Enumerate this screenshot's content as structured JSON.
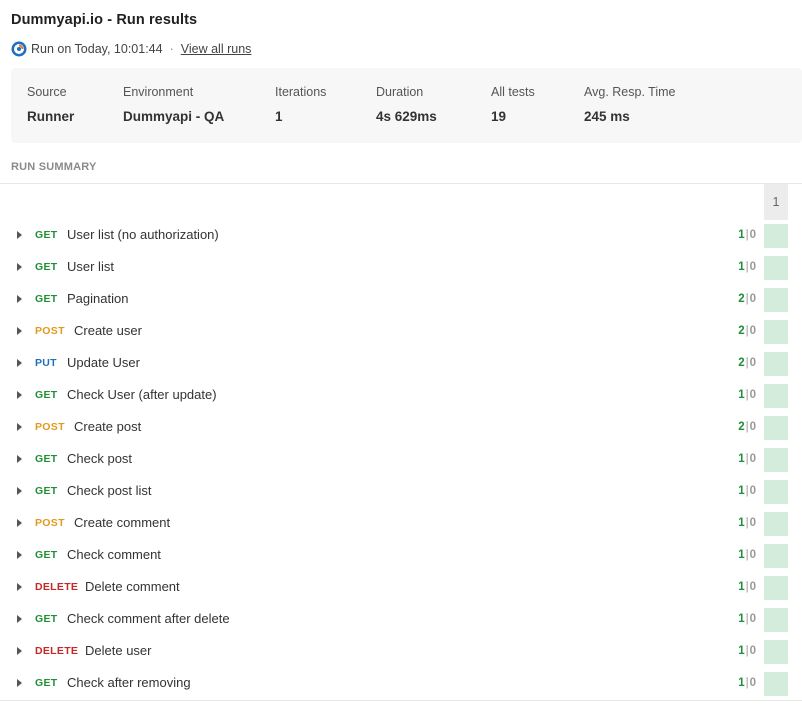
{
  "header": {
    "title": "Dummyapi.io - Run results",
    "run_text": "Run on Today, 10:01:44",
    "separator": "·",
    "view_all": "View all runs"
  },
  "stats": [
    {
      "label": "Source",
      "value": "Runner"
    },
    {
      "label": "Environment",
      "value": "Dummyapi - QA"
    },
    {
      "label": "Iterations",
      "value": "1"
    },
    {
      "label": "Duration",
      "value": "4s 629ms"
    },
    {
      "label": "All tests",
      "value": "19"
    },
    {
      "label": "Avg. Resp. Time",
      "value": "245 ms"
    }
  ],
  "summary": {
    "heading": "RUN SUMMARY",
    "iteration_label": "1"
  },
  "colors": {
    "GET": "#1f8f3a",
    "POST": "#e39a1b",
    "PUT": "#1f6fbf",
    "DELETE": "#c62828",
    "pass_cell": "#d4ecdc"
  },
  "requests": [
    {
      "method": "GET",
      "name": "User list (no authorization)",
      "pass": "1",
      "fail": "0"
    },
    {
      "method": "GET",
      "name": "User list",
      "pass": "1",
      "fail": "0"
    },
    {
      "method": "GET",
      "name": "Pagination",
      "pass": "2",
      "fail": "0"
    },
    {
      "method": "POST",
      "name": "Create user",
      "pass": "2",
      "fail": "0"
    },
    {
      "method": "PUT",
      "name": "Update User",
      "pass": "2",
      "fail": "0"
    },
    {
      "method": "GET",
      "name": "Check User (after update)",
      "pass": "1",
      "fail": "0"
    },
    {
      "method": "POST",
      "name": "Create post",
      "pass": "2",
      "fail": "0"
    },
    {
      "method": "GET",
      "name": "Check post",
      "pass": "1",
      "fail": "0"
    },
    {
      "method": "GET",
      "name": "Check post list",
      "pass": "1",
      "fail": "0"
    },
    {
      "method": "POST",
      "name": "Create comment",
      "pass": "1",
      "fail": "0"
    },
    {
      "method": "GET",
      "name": "Check comment",
      "pass": "1",
      "fail": "0"
    },
    {
      "method": "DELETE",
      "name": "Delete comment",
      "pass": "1",
      "fail": "0"
    },
    {
      "method": "GET",
      "name": "Check comment after delete",
      "pass": "1",
      "fail": "0"
    },
    {
      "method": "DELETE",
      "name": "Delete user",
      "pass": "1",
      "fail": "0"
    },
    {
      "method": "GET",
      "name": "Check after removing",
      "pass": "1",
      "fail": "0"
    }
  ]
}
